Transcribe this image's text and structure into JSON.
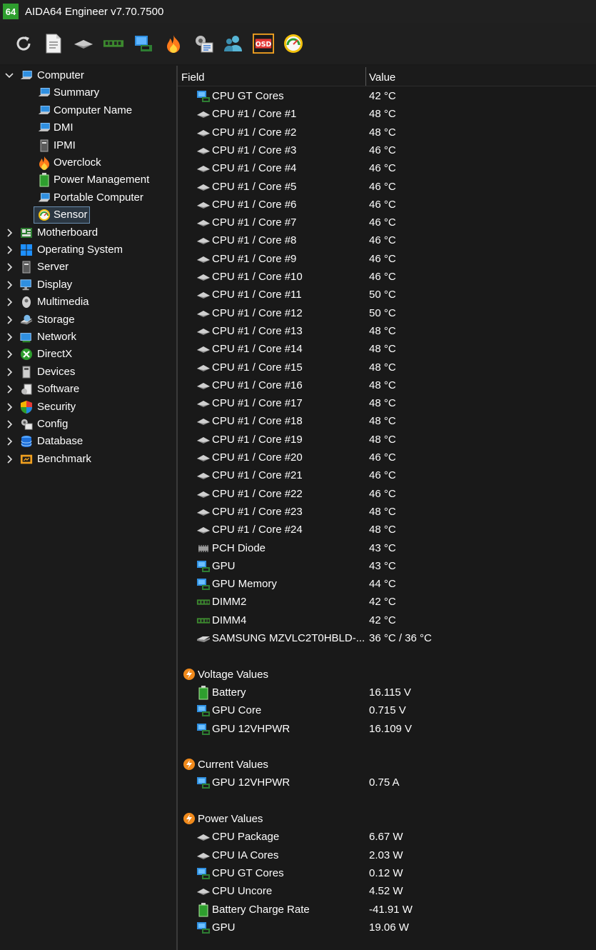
{
  "window": {
    "badge": "64",
    "title": "AIDA64 Engineer v7.70.7500"
  },
  "toolbar": [
    "refresh-icon",
    "report-icon",
    "cpu-chip-icon",
    "memory-icon",
    "display-card-icon",
    "overclock-flame-icon",
    "config-icon",
    "users-icon",
    "osd-icon",
    "sensor-gauge-icon"
  ],
  "toolbar_osd_label": "OSD",
  "tree": {
    "root": "Computer",
    "children": [
      "Summary",
      "Computer Name",
      "DMI",
      "IPMI",
      "Overclock",
      "Power Management",
      "Portable Computer",
      "Sensor"
    ],
    "selected": "Sensor",
    "categories": [
      "Motherboard",
      "Operating System",
      "Server",
      "Display",
      "Multimedia",
      "Storage",
      "Network",
      "DirectX",
      "Devices",
      "Software",
      "Security",
      "Config",
      "Database",
      "Benchmark"
    ]
  },
  "columns": {
    "field": "Field",
    "value": "Value"
  },
  "temperatures": [
    {
      "field": "CPU GT Cores",
      "value": "42 °C",
      "icon": "gpu"
    },
    {
      "field": "CPU #1 / Core #1",
      "value": "48 °C",
      "icon": "cpu"
    },
    {
      "field": "CPU #1 / Core #2",
      "value": "48 °C",
      "icon": "cpu"
    },
    {
      "field": "CPU #1 / Core #3",
      "value": "46 °C",
      "icon": "cpu"
    },
    {
      "field": "CPU #1 / Core #4",
      "value": "46 °C",
      "icon": "cpu"
    },
    {
      "field": "CPU #1 / Core #5",
      "value": "46 °C",
      "icon": "cpu"
    },
    {
      "field": "CPU #1 / Core #6",
      "value": "46 °C",
      "icon": "cpu"
    },
    {
      "field": "CPU #1 / Core #7",
      "value": "46 °C",
      "icon": "cpu"
    },
    {
      "field": "CPU #1 / Core #8",
      "value": "46 °C",
      "icon": "cpu"
    },
    {
      "field": "CPU #1 / Core #9",
      "value": "46 °C",
      "icon": "cpu"
    },
    {
      "field": "CPU #1 / Core #10",
      "value": "46 °C",
      "icon": "cpu"
    },
    {
      "field": "CPU #1 / Core #11",
      "value": "50 °C",
      "icon": "cpu"
    },
    {
      "field": "CPU #1 / Core #12",
      "value": "50 °C",
      "icon": "cpu"
    },
    {
      "field": "CPU #1 / Core #13",
      "value": "48 °C",
      "icon": "cpu"
    },
    {
      "field": "CPU #1 / Core #14",
      "value": "48 °C",
      "icon": "cpu"
    },
    {
      "field": "CPU #1 / Core #15",
      "value": "48 °C",
      "icon": "cpu"
    },
    {
      "field": "CPU #1 / Core #16",
      "value": "48 °C",
      "icon": "cpu"
    },
    {
      "field": "CPU #1 / Core #17",
      "value": "48 °C",
      "icon": "cpu"
    },
    {
      "field": "CPU #1 / Core #18",
      "value": "48 °C",
      "icon": "cpu"
    },
    {
      "field": "CPU #1 / Core #19",
      "value": "48 °C",
      "icon": "cpu"
    },
    {
      "field": "CPU #1 / Core #20",
      "value": "46 °C",
      "icon": "cpu"
    },
    {
      "field": "CPU #1 / Core #21",
      "value": "46 °C",
      "icon": "cpu"
    },
    {
      "field": "CPU #1 / Core #22",
      "value": "46 °C",
      "icon": "cpu"
    },
    {
      "field": "CPU #1 / Core #23",
      "value": "48 °C",
      "icon": "cpu"
    },
    {
      "field": "CPU #1 / Core #24",
      "value": "48 °C",
      "icon": "cpu"
    },
    {
      "field": "PCH Diode",
      "value": "43 °C",
      "icon": "chip"
    },
    {
      "field": "GPU",
      "value": "43 °C",
      "icon": "gpu"
    },
    {
      "field": "GPU Memory",
      "value": "44 °C",
      "icon": "gpu"
    },
    {
      "field": "DIMM2",
      "value": "42 °C",
      "icon": "ram"
    },
    {
      "field": "DIMM4",
      "value": "42 °C",
      "icon": "ram"
    },
    {
      "field": "SAMSUNG MZVLC2T0HBLD-...",
      "value": "36 °C / 36 °C",
      "icon": "disk"
    }
  ],
  "sections": [
    {
      "title": "Voltage Values",
      "rows": [
        {
          "field": "Battery",
          "value": "16.115 V",
          "icon": "battery"
        },
        {
          "field": "GPU Core",
          "value": "0.715 V",
          "icon": "gpu"
        },
        {
          "field": "GPU 12VHPWR",
          "value": "16.109 V",
          "icon": "gpu"
        }
      ]
    },
    {
      "title": "Current Values",
      "rows": [
        {
          "field": "GPU 12VHPWR",
          "value": "0.75 A",
          "icon": "gpu"
        }
      ]
    },
    {
      "title": "Power Values",
      "rows": [
        {
          "field": "CPU Package",
          "value": "6.67 W",
          "icon": "cpu"
        },
        {
          "field": "CPU IA Cores",
          "value": "2.03 W",
          "icon": "cpu"
        },
        {
          "field": "CPU GT Cores",
          "value": "0.12 W",
          "icon": "gpu"
        },
        {
          "field": "CPU Uncore",
          "value": "4.52 W",
          "icon": "cpu"
        },
        {
          "field": "Battery Charge Rate",
          "value": "-41.91 W",
          "icon": "battery"
        },
        {
          "field": "GPU",
          "value": "19.06 W",
          "icon": "gpu"
        }
      ]
    }
  ],
  "colors": {
    "background": "#1a1a1a",
    "text": "#ffffff",
    "selection": "#2b3742",
    "accent_green": "#2e9e2e"
  }
}
